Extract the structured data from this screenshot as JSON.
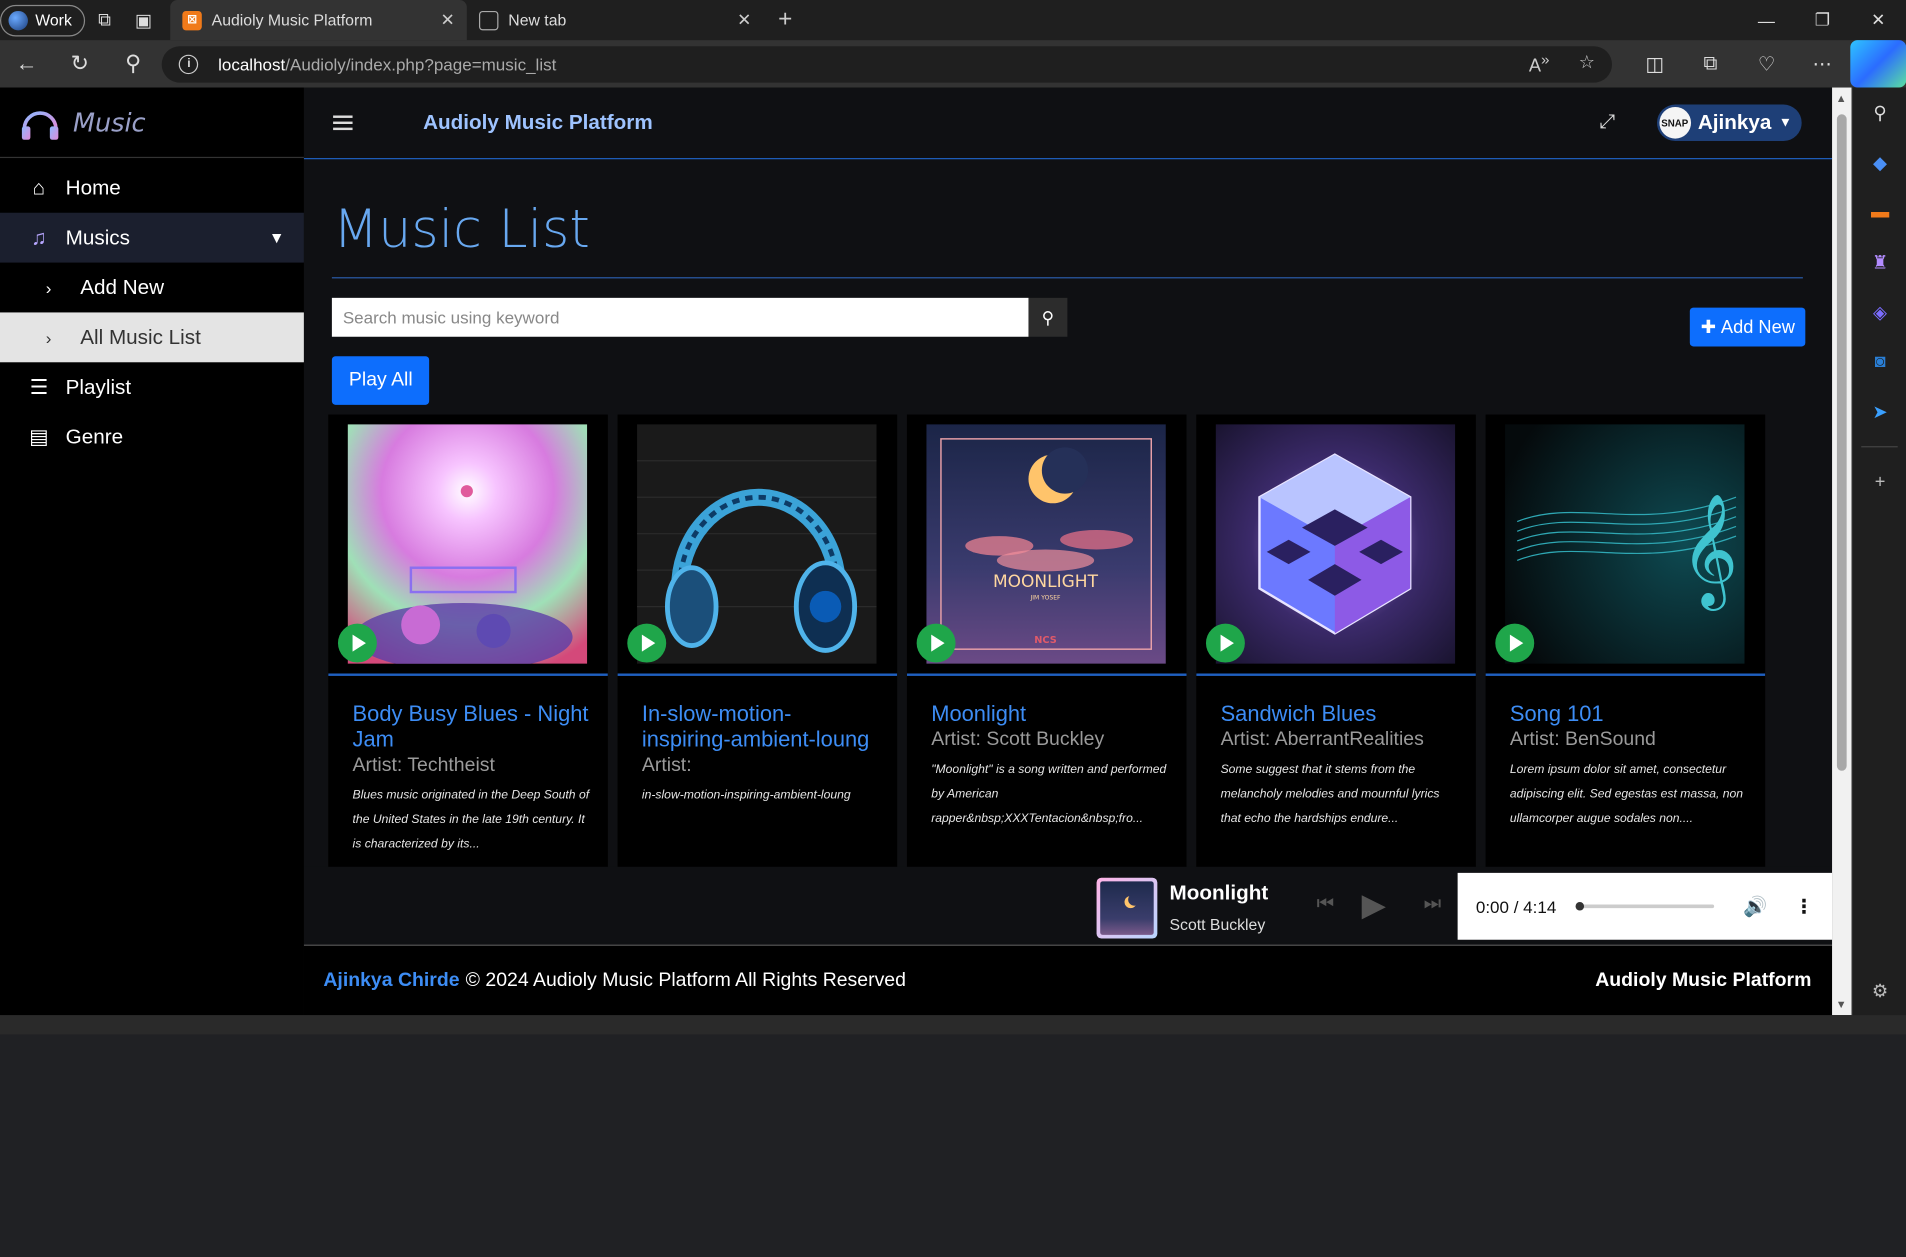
{
  "browser": {
    "workspace_label": "Work",
    "tabs": [
      {
        "title": "Audioly Music Platform",
        "icon": "xampp-icon"
      },
      {
        "title": "New tab",
        "icon": "newtab-icon"
      }
    ],
    "address": {
      "host": "localhost",
      "path": "/Audioly/index.php?page=music_list"
    }
  },
  "sidebar": {
    "brand": "Music",
    "items": [
      {
        "label": "Home",
        "icon": "home-icon"
      },
      {
        "label": "Musics",
        "icon": "music-icon"
      },
      {
        "label": "Add New",
        "icon": "chevron-right-icon"
      },
      {
        "label": "All Music List",
        "icon": "chevron-right-icon"
      },
      {
        "label": "Playlist",
        "icon": "list-icon"
      },
      {
        "label": "Genre",
        "icon": "table-list-icon"
      }
    ]
  },
  "header": {
    "site_title": "Audioly Music Platform",
    "user_name": "Ajinkya",
    "avatar_text": "SNAP"
  },
  "main": {
    "title": "Music List",
    "search_placeholder": "Search music using keyword",
    "add_new_label": "Add New",
    "play_all_label": "Play All"
  },
  "cards": [
    {
      "title": "Body Busy Blues - Night Jam",
      "artist": "Artist: Techtheist",
      "desc": "Blues music originated in the Deep South of the United States in the late 19th century. It is characterized by its..."
    },
    {
      "title": "In-slow-motion-inspiring-ambient-loung",
      "artist": "Artist:",
      "desc": "in-slow-motion-inspiring-ambient-loung"
    },
    {
      "title": "Moonlight",
      "artist": "Artist: Scott Buckley",
      "desc": "\"Moonlight\" is a song written and performed by American rapper&nbsp;XXXTentacion&nbsp;fro...",
      "cover_title": "MOONLIGHT",
      "cover_sub": "JIM YOSEF",
      "cover_logo": "NCS"
    },
    {
      "title": "Sandwich Blues",
      "artist": "Artist: AberrantRealities",
      "desc": "Some suggest that it stems from the melancholy melodies and mournful lyrics that echo the hardships endure..."
    },
    {
      "title": "Song 101",
      "artist": "Artist: BenSound",
      "desc": "Lorem ipsum dolor sit amet, consectetur adipiscing elit. Sed egestas est massa, non ullamcorper augue sodales non...."
    }
  ],
  "player": {
    "title": "Moonlight",
    "artist": "Scott Buckley",
    "time": "0:00 / 4:14",
    "progress": 0.0
  },
  "footer": {
    "author": "Ajinkya Chirde",
    "copyright": "© 2024 Audioly Music Platform All Rights Reserved",
    "brand": "Audioly Music Platform"
  },
  "colors": {
    "accent": "#0d6efd",
    "link": "#3d8df5",
    "title": "#68a8f0",
    "play": "#1fa64a"
  }
}
